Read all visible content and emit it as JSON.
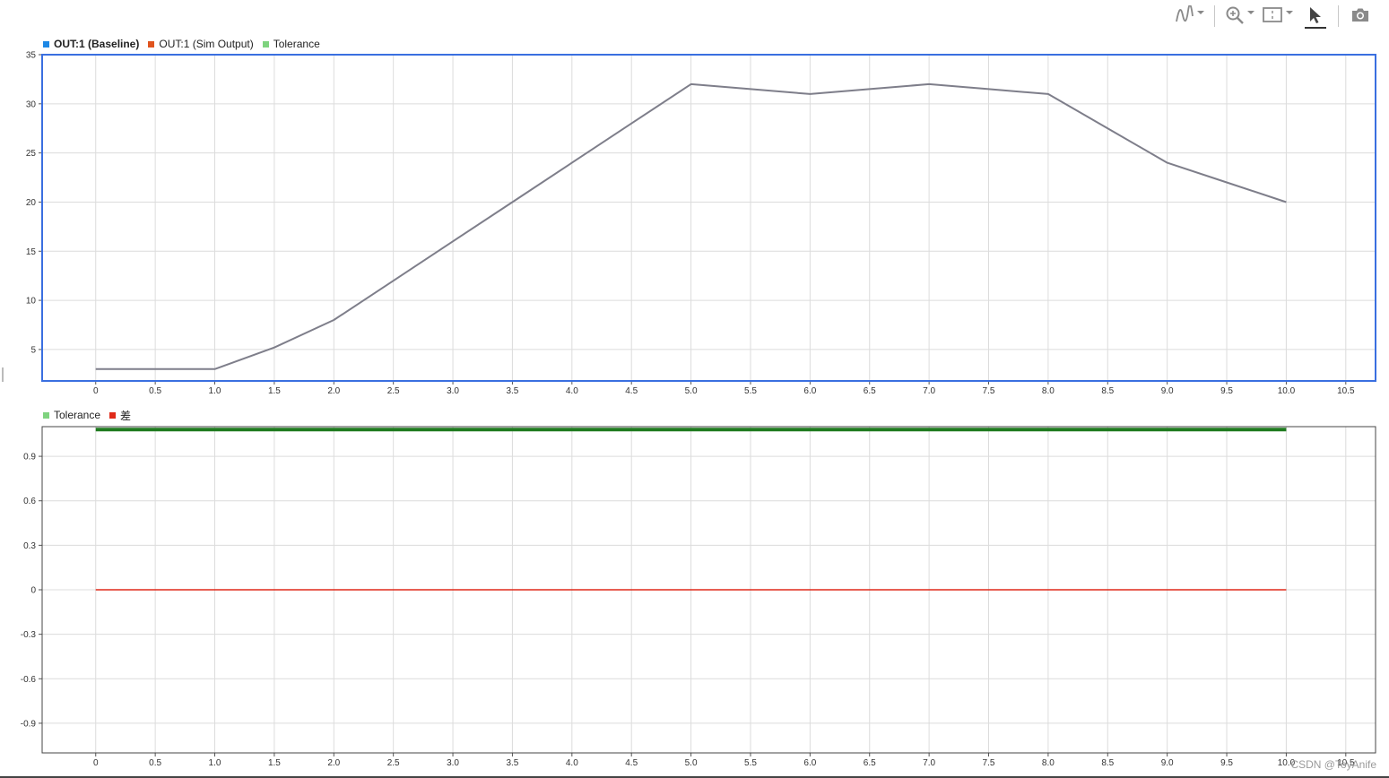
{
  "toolbar": {
    "icons": [
      "signal-icon",
      "zoom-in-icon",
      "fit-to-view-icon",
      "cursor-icon",
      "camera-icon"
    ]
  },
  "colors": {
    "baseline": "#1e88e5",
    "sim_output": "#e0541e",
    "tolerance": "#7fd37f",
    "tolerance_band": "#1f7a1f",
    "diff": "#e02a1a",
    "signal_line": "#7e7e8a",
    "selected_border": "#3a6fe0",
    "grid": "#dcdcdc"
  },
  "chart_data": [
    {
      "type": "line",
      "legend": [
        {
          "label": "OUT:1 (Baseline)",
          "bold": true,
          "color": "#1e88e5"
        },
        {
          "label": "OUT:1 (Sim Output)",
          "bold": false,
          "color": "#e0541e"
        },
        {
          "label": "Tolerance",
          "bold": false,
          "color": "#7fd37f"
        }
      ],
      "xlim": [
        -0.45,
        10.75
      ],
      "ylim": [
        1.8,
        35
      ],
      "x_ticks": [
        "0",
        "0.5",
        "1.0",
        "1.5",
        "2.0",
        "2.5",
        "3.0",
        "3.5",
        "4.0",
        "4.5",
        "5.0",
        "5.5",
        "6.0",
        "6.5",
        "7.0",
        "7.5",
        "8.0",
        "8.5",
        "9.0",
        "9.5",
        "10.0",
        "10.5"
      ],
      "y_ticks": [
        "5",
        "10",
        "15",
        "20",
        "25",
        "30",
        "35"
      ],
      "grid": true,
      "selected": true,
      "series": [
        {
          "x": [
            0,
            0.5,
            1.0,
            1.5,
            2.0,
            2.5,
            3.0,
            3.5,
            4.0,
            4.5,
            5.0,
            5.5,
            6.0,
            6.5,
            7.0,
            7.5,
            8.0,
            8.5,
            9.0,
            9.5,
            10.0
          ],
          "y": [
            3,
            3,
            3,
            5.2,
            8,
            12,
            16,
            20,
            24,
            28,
            32,
            31.5,
            31,
            31.5,
            32,
            31.5,
            31,
            27.5,
            24,
            22,
            20
          ]
        }
      ]
    },
    {
      "type": "line",
      "legend": [
        {
          "label": "Tolerance",
          "bold": false,
          "color": "#7fd37f"
        },
        {
          "label": "差",
          "bold": false,
          "color": "#e02a1a"
        }
      ],
      "xlim": [
        -0.45,
        10.75
      ],
      "ylim": [
        -1.1,
        1.1
      ],
      "x_ticks": [
        "0",
        "0.5",
        "1.0",
        "1.5",
        "2.0",
        "2.5",
        "3.0",
        "3.5",
        "4.0",
        "4.5",
        "5.0",
        "5.5",
        "6.0",
        "6.5",
        "7.0",
        "7.5",
        "8.0",
        "8.5",
        "9.0",
        "9.5",
        "10.0",
        "10.5"
      ],
      "y_ticks": [
        "0.9",
        "0.6",
        "0.3",
        "0",
        "-0.3",
        "-0.6",
        "-0.9"
      ],
      "grid": true,
      "selected": false,
      "series": [
        {
          "name": "Tolerance",
          "x": [
            0,
            10.0
          ],
          "y": [
            1.08,
            1.08
          ]
        },
        {
          "name": "差",
          "x": [
            0,
            10.0
          ],
          "y": [
            0,
            0
          ]
        }
      ]
    }
  ],
  "watermark": "CSDN @ToyAnife"
}
